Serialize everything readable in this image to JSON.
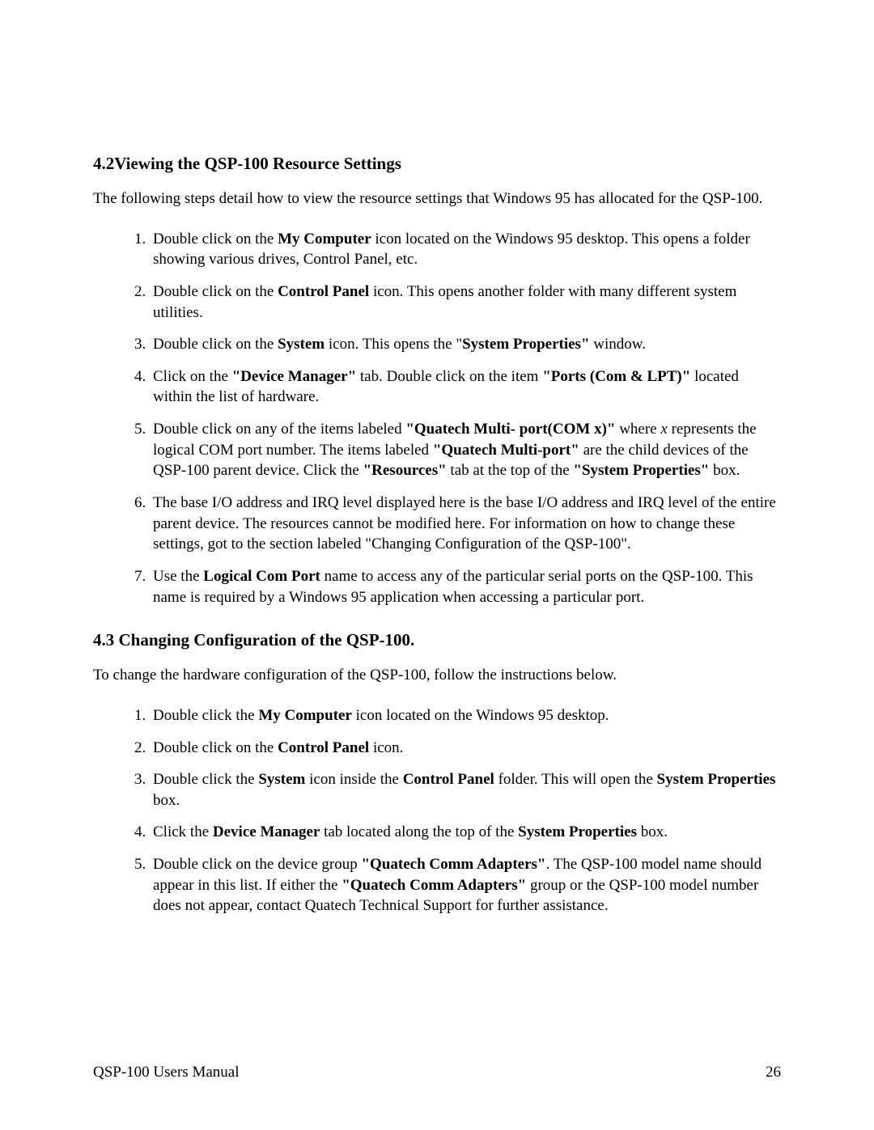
{
  "section42": {
    "heading_num": "4.2",
    "heading_text": "Viewing the QSP-100 Resource Settings",
    "intro": "The following steps  detail how to view the resource  settings that Windows 95 has allocated for the QSP-100.",
    "items": {
      "i1a": "Double click on the ",
      "i1b": "My Computer",
      "i1c": " icon located on the Windows 95 desktop.  This opens a folder showing various drives, Control Panel, etc.",
      "i2a": "Double click on the ",
      "i2b": "Control Panel",
      "i2c": " icon.  This opens another folder with many different system utilities.",
      "i3a": "Double click on the ",
      "i3b": "System",
      "i3c": " icon.  This opens the \"",
      "i3d": "System Properties\"",
      "i3e": " window.",
      "i4a": "Click on the ",
      "i4b": "\"Device Manager\"",
      "i4c": " tab.  Double click on the item ",
      "i4d": "\"Ports (Com & LPT)\"",
      "i4e": " located within the list of hardware.",
      "i5a": "Double click on any of the items labeled ",
      "i5b": "\"Quatech Multi- port(COM x)\"",
      "i5c": " where ",
      "i5d": "x",
      "i5e": " represents the logical COM port number.  The items labeled ",
      "i5f": "\"Quatech Multi-port\"",
      "i5g": " are the child devices of the QSP-100 parent device.  Click the ",
      "i5h": "\"Resources\"",
      "i5i": " tab at the top of the ",
      "i5j": "\"System Properties\"",
      "i5k": " box.",
      "i6": "The base I/O address  and IRQ level displayed here is the base I/O address and IRQ level of the entire parent device.  The resources cannot be modified here.  For information on how to change these settings, got to the section labeled \"Changing Configuration of the QSP-100\".",
      "i7a": "Use the ",
      "i7b": "Logical Com Port",
      "i7c": " name to access any of the particular serial ports on the QSP-100.  This name is required by a Windows 95 application when accessing a particular port."
    }
  },
  "section43": {
    "heading_num": "4.3",
    "heading_text": " Changing Configuration of the QSP-100.",
    "intro": "To change the hardware  configuration of the QSP-100, follow the instructions below.",
    "items": {
      "i1a": "Double click the ",
      "i1b": "My Computer",
      "i1c": " icon located on the Windows 95 desktop.",
      "i2a": "Double click on the ",
      "i2b": "Control Panel",
      "i2c": " icon.",
      "i3a": "Double click the ",
      "i3b": "System",
      "i3c": " icon inside the ",
      "i3d": "Control Panel",
      "i3e": " folder.  This will open the ",
      "i3f": "System Properties",
      "i3g": " box.",
      "i4a": "Click the ",
      "i4b": "Device Manager",
      "i4c": " tab located along the top of the ",
      "i4d": "System Properties",
      "i4e": " box.",
      "i5a": "Double click on the device group ",
      "i5b": "\"Quatech Comm Adapters\"",
      "i5c": ".  The QSP-100 model name should appear in this list.  If either the ",
      "i5d": "\"Quatech Comm Adapters\"",
      "i5e": " group or the QSP-100 model number does not appear, contact Quatech Technical Support for further assistance."
    }
  },
  "footer": {
    "left": "QSP-100 Users Manual",
    "right": "26"
  }
}
